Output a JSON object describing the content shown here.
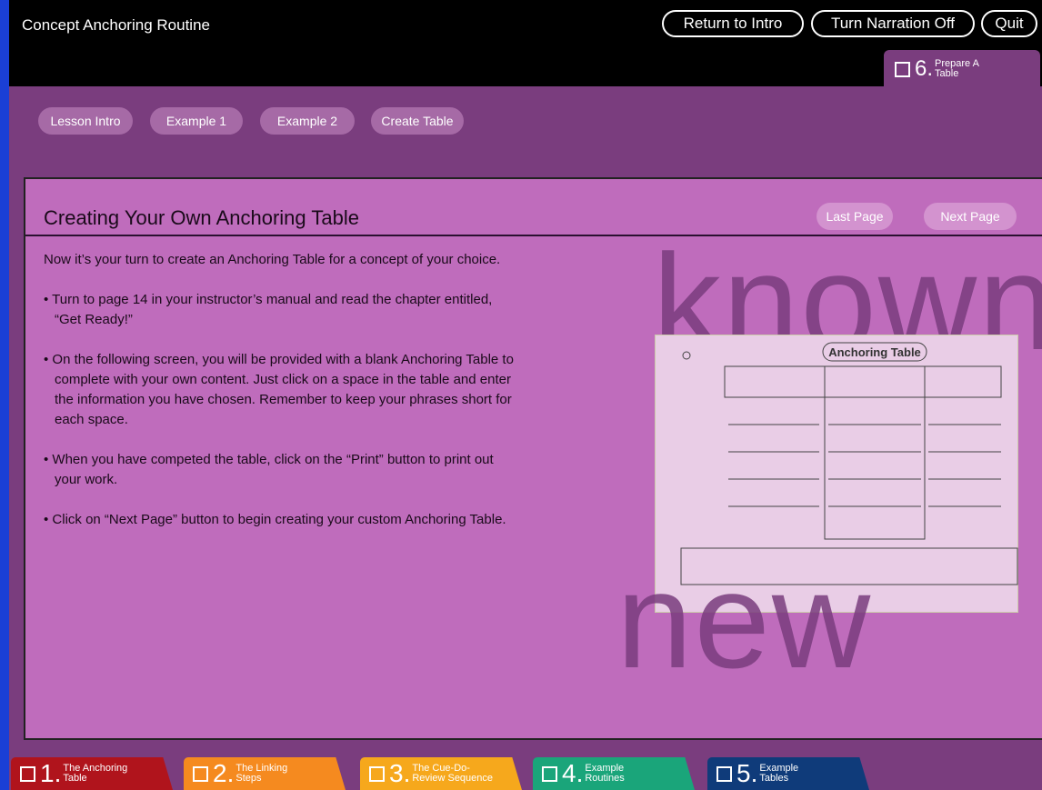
{
  "app": {
    "title": "Concept Anchoring Routine"
  },
  "top_buttons": {
    "return_intro": "Return to Intro",
    "narration": "Turn Narration Off",
    "quit": "Quit"
  },
  "active_tab": {
    "number": "6.",
    "label_line1": "Prepare A",
    "label_line2": "Table"
  },
  "nav_pills": [
    "Lesson Intro",
    "Example 1",
    "Example 2",
    "Create Table"
  ],
  "panel": {
    "title": "Creating Your Own Anchoring Table",
    "last_page": "Last Page",
    "next_page": "Next Page",
    "intro": "Now it’s your turn to create an Anchoring Table for a concept of your choice.",
    "bullets": [
      "• Turn to page 14 in your instructor’s manual and read the chapter entitled, “Get Ready!”",
      "• On the following screen, you will be provided with a blank Anchoring Table to complete with your own content. Just click on a space in the table and enter the information you have chosen. Remember to keep your phrases short for each space.",
      "• When you have competed the table, click on the “Print” button to print out your work.",
      "• Click on “Next Page” button to begin creating your custom Anchoring Table."
    ],
    "watermark_top": "known",
    "watermark_bottom": "new",
    "thumbnail_title": "Anchoring Table"
  },
  "bottom_tabs": [
    {
      "number": "1.",
      "line1": "The Anchoring",
      "line2": "Table",
      "color": "#b0141c"
    },
    {
      "number": "2.",
      "line1": "The Linking",
      "line2": "Steps",
      "color": "#f58a1f"
    },
    {
      "number": "3.",
      "line1": "The Cue-Do-",
      "line2": "Review Sequence",
      "color": "#f6a81c"
    },
    {
      "number": "4.",
      "line1": "Example",
      "line2": "Routines",
      "color": "#1aa57a"
    },
    {
      "number": "5.",
      "line1": "Example",
      "line2": "Tables",
      "color": "#0f3b7a"
    }
  ]
}
